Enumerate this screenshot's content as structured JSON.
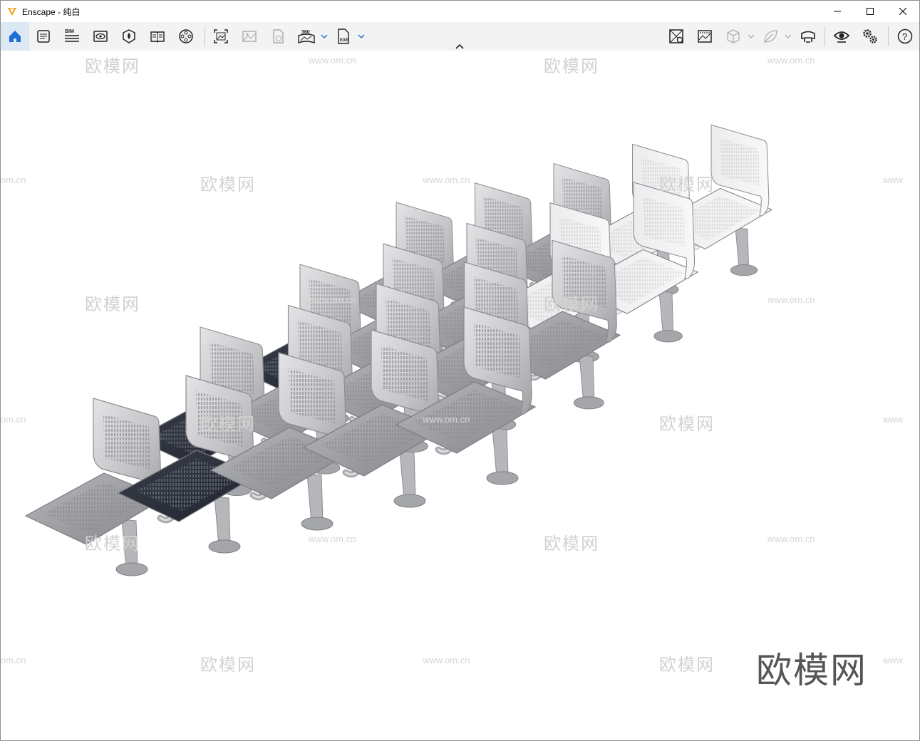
{
  "window": {
    "title": "Enscape - 纯白",
    "controls": [
      "minimize",
      "maximize",
      "close"
    ]
  },
  "toolbar": {
    "left_group": [
      {
        "name": "home-icon",
        "active": true
      },
      {
        "name": "notes-icon"
      },
      {
        "name": "bim-icon",
        "label": "BIM"
      },
      {
        "name": "view-icon"
      },
      {
        "name": "asset-library-icon"
      },
      {
        "name": "book-icon"
      },
      {
        "name": "video-reel-icon"
      }
    ],
    "capture_group": [
      {
        "name": "screenshot-icon"
      },
      {
        "name": "batch-render-icon",
        "disabled": true
      },
      {
        "name": "web-standalone-icon",
        "disabled": true
      },
      {
        "name": "panorama-360-icon",
        "label": "360",
        "dropdown": true
      },
      {
        "name": "export-exe-icon",
        "label": "EXE",
        "dropdown": true
      }
    ],
    "right_group": [
      {
        "name": "site-context-icon"
      },
      {
        "name": "atmosphere-icon"
      },
      {
        "name": "cube-icon",
        "disabled": true,
        "dropdown": true
      },
      {
        "name": "leaf-icon",
        "disabled": true,
        "dropdown": true
      },
      {
        "name": "vr-headset-icon"
      },
      {
        "name": "eye-visual-settings-icon"
      },
      {
        "name": "settings-gears-icon"
      },
      {
        "name": "help-icon"
      }
    ]
  },
  "watermarks": {
    "logo_text": "欧模网",
    "url_text": "www.om.cn",
    "url_partial_left": "om.cn",
    "url_partial_right": "www."
  },
  "brand_watermark": "欧模网",
  "scene": {
    "object": "waiting-room-chairs",
    "rows": 4,
    "seats_per_row": 5,
    "colors": {
      "chrome": "#c7c7c9",
      "chrome_dark": "#8c8c90",
      "seat_dark": "#2f3440",
      "background": "#ffffff"
    }
  }
}
